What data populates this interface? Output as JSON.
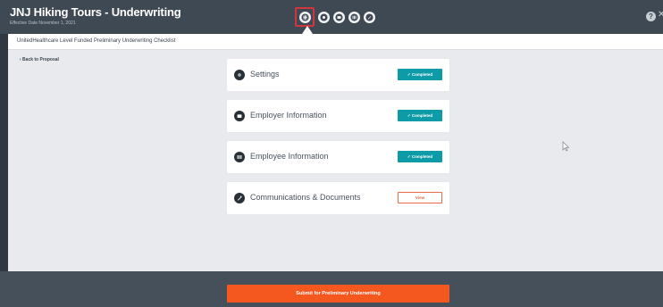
{
  "header": {
    "title": "JNJ Hiking Tours - Underwriting",
    "subtitle": "Effective Date November 1, 2021"
  },
  "step_nav": {
    "steps": [
      {
        "icon": "checklist-icon",
        "current": true
      },
      {
        "icon": "settings-icon",
        "current": false
      },
      {
        "icon": "employer-icon",
        "current": false
      },
      {
        "icon": "employee-icon",
        "current": false
      },
      {
        "icon": "documents-icon",
        "current": false
      }
    ]
  },
  "subheader": {
    "text": "UnitedHealthcare Level Funded Preliminary Underwriting Checklist"
  },
  "back_link": "‹ Back to Proposal",
  "cards": [
    {
      "label": "Settings",
      "status": "✓ Completed",
      "icon": "settings-icon"
    },
    {
      "label": "Employer Information",
      "status": "✓ Completed",
      "icon": "employer-icon"
    },
    {
      "label": "Employee Information",
      "status": "✓ Completed",
      "icon": "employee-icon"
    },
    {
      "label": "Communications & Documents",
      "status": "View",
      "icon": "documents-icon"
    }
  ],
  "footer": {
    "submit_label": "Submit for Preliminary Underwriting"
  },
  "colors": {
    "header_bg": "#3f4953",
    "completed": "#0d9ba8",
    "accent": "#f5581f",
    "highlight": "#d0363c"
  }
}
